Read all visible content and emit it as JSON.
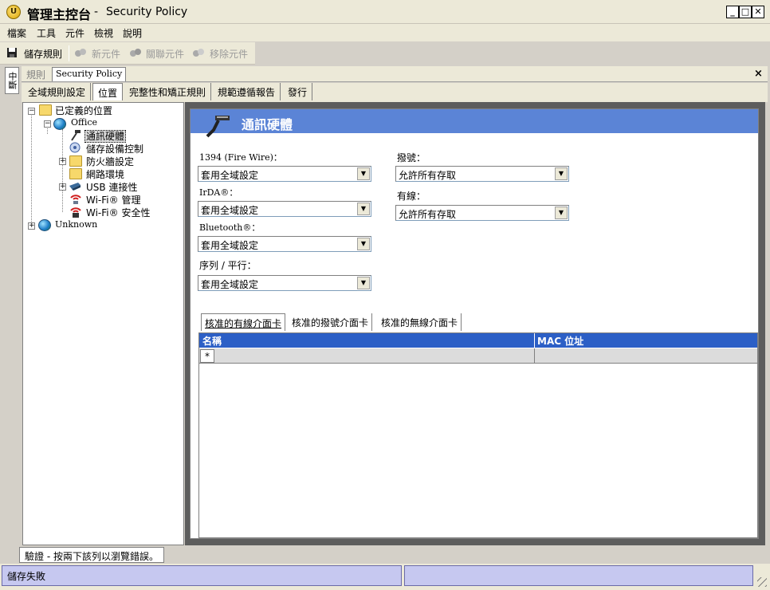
{
  "window": {
    "title_main": "管理主控台",
    "title_sep": "-",
    "title_sub": "Security Policy",
    "min_label": "_",
    "max_label": "□",
    "close_label": "✕",
    "app_icon_glyph": "U"
  },
  "menu": [
    "檔案",
    "工具",
    "元件",
    "檢視",
    "說明"
  ],
  "toolbar": {
    "save": "儲存規則",
    "new_component": "新元件",
    "link_component": "關聯元件",
    "remove_component": "移除元件"
  },
  "side_tab": "中斷",
  "doc_tabs": {
    "rule": "規則",
    "policy": "Security Policy",
    "close": "×"
  },
  "main_tabs": [
    "全域規則設定",
    "位置",
    "完整性和矯正規則",
    "規範遵循報告",
    "發行"
  ],
  "active_main_tab": "位置",
  "tree": {
    "root": "已定義的位置",
    "office": "Office",
    "items": [
      "通訊硬體",
      "儲存設備控制",
      "防火牆設定",
      "網路環境",
      "USB 連接性",
      "Wi-Fi® 管理",
      "Wi-Fi® 安全性"
    ],
    "unknown": "Unknown",
    "expand_plus": "+",
    "expand_minus": "−"
  },
  "content": {
    "header_title": "通訊硬體",
    "left_fields": [
      {
        "label": "1394 (Fire Wire)：",
        "value": "套用全域設定"
      },
      {
        "label": "IrDA®：",
        "value": "套用全域設定"
      },
      {
        "label": "Bluetooth®：",
        "value": "套用全域設定"
      },
      {
        "label": "序列 / 平行：",
        "value": "套用全域設定"
      }
    ],
    "right_fields": [
      {
        "label": "撥號：",
        "value": "允許所有存取"
      },
      {
        "label": "有線：",
        "value": "允許所有存取"
      }
    ],
    "dropdown_arrow": "▼"
  },
  "sub_tabs": [
    "核准的有線介面卡",
    "核准的撥號介面卡",
    "核准的無線介面卡"
  ],
  "grid": {
    "columns": [
      "名稱",
      "MAC 位址"
    ],
    "new_row_marker": "*"
  },
  "bottom": {
    "validate": "驗證 - 按兩下該列以瀏覽錯誤。",
    "status_left": "儲存失敗",
    "status_right": ""
  },
  "colors": {
    "header_blue": "#5b84d6",
    "grid_header": "#2c5fc6",
    "status_panel": "#c6c8f0"
  }
}
